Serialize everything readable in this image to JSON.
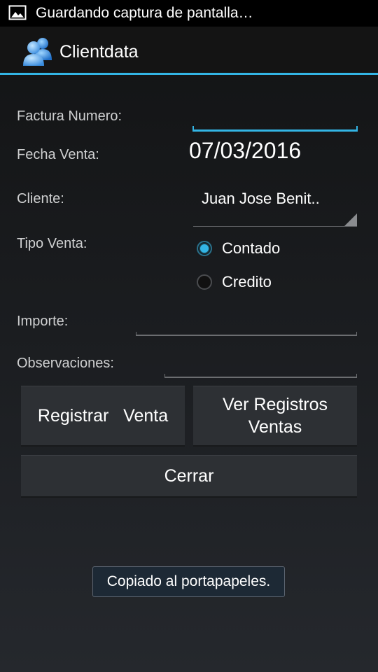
{
  "status_bar": {
    "icon": "picture-icon",
    "notification_text": "Guardando captura de pantalla…"
  },
  "action_bar": {
    "icon": "users-icon",
    "title": "Clientdata"
  },
  "form": {
    "factura_label": "Factura Numero:",
    "factura_value": "",
    "fecha_label": "Fecha Venta:",
    "fecha_value": "07/03/2016",
    "cliente_label": "Cliente:",
    "cliente_value": "Juan Jose Benit..",
    "tipo_label": "Tipo Venta:",
    "tipo_options": [
      {
        "label": "Contado",
        "checked": true
      },
      {
        "label": "Credito",
        "checked": false
      }
    ],
    "importe_label": "Importe:",
    "importe_value": "",
    "observaciones_label": "Observaciones:",
    "observaciones_value": ""
  },
  "buttons": {
    "registrar": "Registrar   Venta",
    "ver_registros_line1": "Ver Registros",
    "ver_registros_line2": "Ventas",
    "cerrar": "Cerrar"
  },
  "toast": {
    "message": "Copiado al portapapeles."
  },
  "colors": {
    "accent": "#33b5e5",
    "background": "#1a1c1f",
    "button": "#2d3034"
  }
}
